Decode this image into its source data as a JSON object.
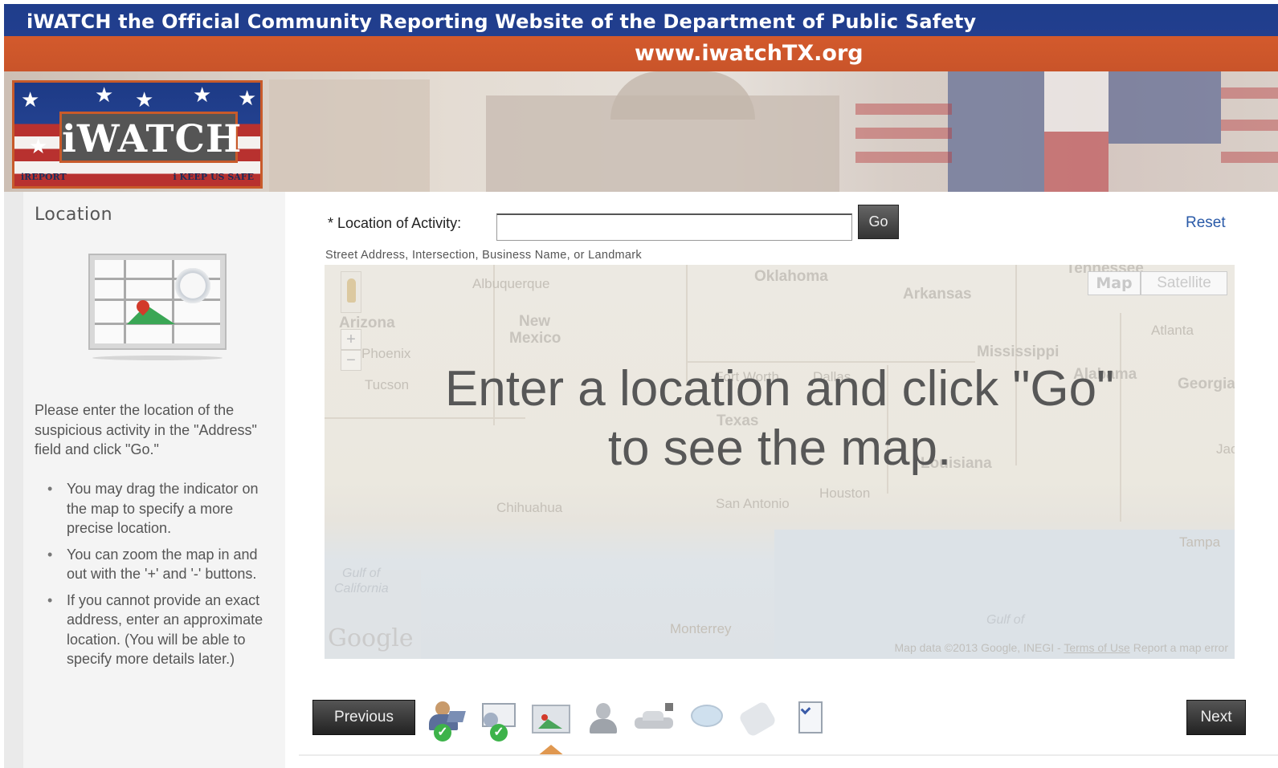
{
  "header": {
    "title": "iWATCH the Official Community Reporting Website of the Department of Public Safety",
    "url": "www.iwatchTX.org"
  },
  "logo": {
    "title": "iWATCH",
    "tagline_left": "iREPORT",
    "tagline_right": "i KEEP US SAFE"
  },
  "sidebar": {
    "title": "Location",
    "intro": "Please enter the location of the suspicious activity in the \"Address\" field and click \"Go.\"",
    "tips": [
      "You may drag the indicator on the map to specify a more precise location.",
      "You can zoom the map in and out with the '+' and '-' buttons.",
      "If you cannot provide an exact address, enter an approximate location. (You will be able to specify more details later.)"
    ]
  },
  "form": {
    "location_label": "* Location of Activity:",
    "location_value": "",
    "location_hint": "Street Address, Intersection, Business Name, or Landmark",
    "go_label": "Go",
    "reset_label": "Reset"
  },
  "map": {
    "overlay_line1": "Enter a location and click \"Go\"",
    "overlay_line2": "to see the map.",
    "map_type_map": "Map",
    "map_type_satellite": "Satellite",
    "zoom_in": "+",
    "zoom_out": "−",
    "google": "Google",
    "attribution_data": "Map data ©2013 Google, INEGI -",
    "attribution_terms": "Terms of Use",
    "attribution_report": "Report a map error",
    "places": {
      "albuquerque": "Albuquerque",
      "oklahoma": "Oklahoma",
      "arkansas": "Arkansas",
      "tennessee": "Tennessee",
      "arizona": "Arizona",
      "new_mexico_1": "New",
      "new_mexico_2": "Mexico",
      "phoenix": "Phoenix",
      "mississippi": "Mississippi",
      "atlanta": "Atlanta",
      "georgia": "Georgia",
      "tucson": "Tucson",
      "fort_worth": "Fort Worth",
      "dallas": "Dallas",
      "alabama": "Alabama",
      "texas": "Texas",
      "louisiana": "Louisiana",
      "jac": "Jac",
      "houston": "Houston",
      "chihuahua": "Chihuahua",
      "san_antonio": "San Antonio",
      "tampa": "Tampa",
      "gulf_california_1": "Gulf of",
      "gulf_california_2": "California",
      "gulf_of": "Gulf of",
      "monterrey": "Monterrey"
    }
  },
  "nav": {
    "previous_label": "Previous",
    "next_label": "Next",
    "steps": [
      {
        "name": "person-step-icon",
        "completed": true
      },
      {
        "name": "activity-step-icon",
        "completed": true
      },
      {
        "name": "location-step-icon",
        "completed": false,
        "current": true
      },
      {
        "name": "suspect-step-icon",
        "completed": false
      },
      {
        "name": "vehicle-step-icon",
        "completed": false
      },
      {
        "name": "comments-step-icon",
        "completed": false
      },
      {
        "name": "contact-step-icon",
        "completed": false
      },
      {
        "name": "review-step-icon",
        "completed": false
      }
    ]
  },
  "colors": {
    "header_blue": "#1f3d8c",
    "header_orange": "#d35a2c",
    "link_blue": "#2a5aa8",
    "check_green": "#3db34a"
  }
}
